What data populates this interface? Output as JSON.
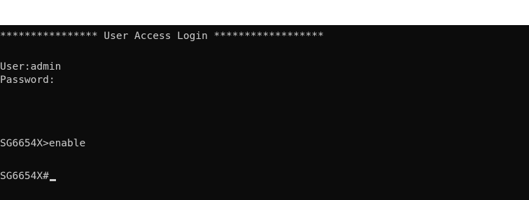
{
  "terminal": {
    "banner": "**************** User Access Login ******************",
    "user_line": "User:admin",
    "password_line": "Password:",
    "enable_line": "SG6654X>enable",
    "prompt_line": "SG6654X#",
    "colors": {
      "background": "#0c0c0c",
      "text": "#cccccc",
      "page": "#ffffff"
    },
    "cursor_icon": "underscore-cursor-icon"
  }
}
